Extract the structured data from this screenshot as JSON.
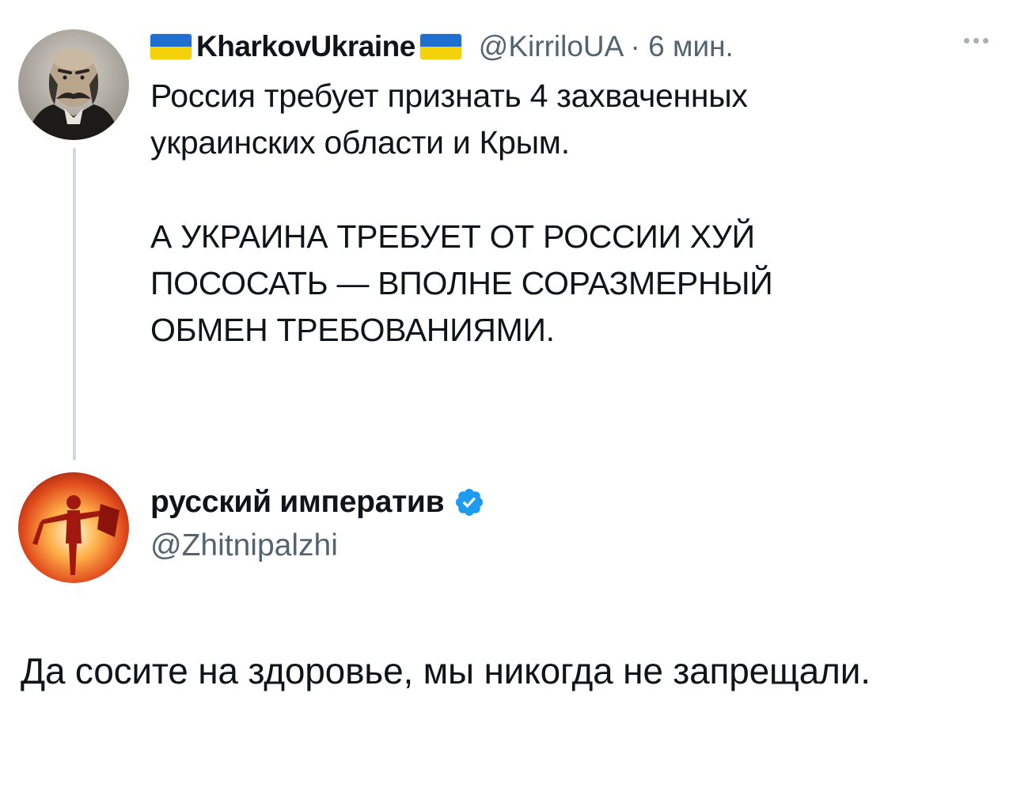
{
  "parent_tweet": {
    "display_name": "KharkovUkraine",
    "handle_time": "@KirriloUA · 6 мин.",
    "text_1": "Россия требует признать 4 захваченных\nукраинских области и Крым.",
    "text_2": "А УКРАИНА ТРЕБУЕТ ОТ РОССИИ ХУЙ\nПОСОСАТЬ — ВПОЛНЕ СОРАЗМЕРНЫЙ\nОБМЕН ТРЕБОВАНИЯМИ.",
    "flag_colors": {
      "blue": "#1f6fd1",
      "yellow": "#f5d10a"
    },
    "avatar_icon": "portrait-avatar-icon",
    "more_icon": "more-options-icon"
  },
  "reply_tweet": {
    "display_name": "русский императив",
    "handle": "@Zhitnipalzhi",
    "text": "Да сосите на здоровье, мы никогда не запрещали.",
    "verified_color": "#1d9bf0",
    "avatar_icon": "fire-figure-avatar-icon"
  },
  "colors": {
    "text_primary": "#0f1419",
    "text_secondary": "#536471",
    "thread_line": "#cfd9de"
  }
}
